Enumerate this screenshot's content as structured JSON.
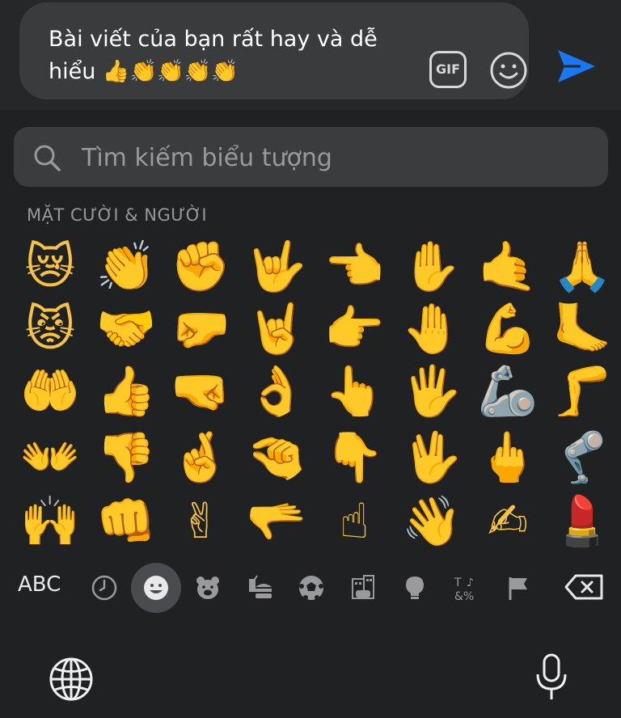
{
  "composer": {
    "message_text": "Bài viết của bạn rất hay và dễ hiểu 👍👏👏👏👏",
    "gif_label": "GIF"
  },
  "search": {
    "placeholder": "Tìm kiếm biểu tượng"
  },
  "category": {
    "title": "MẶT CƯỜI & NGƯỜI"
  },
  "emoji_grid": [
    [
      "😿",
      "👏",
      "✊",
      "🤟",
      "👈",
      "✋",
      "🤙",
      "🙏"
    ],
    [
      "😾",
      "🤝",
      "🤛",
      "🤘",
      "👉",
      "🤚",
      "💪",
      "🦶"
    ],
    [
      "🤲",
      "👍",
      "🤜",
      "👌",
      "👆",
      "🖐",
      "🦾",
      "🦵"
    ],
    [
      "👐",
      "👎",
      "🤞",
      "🤏",
      "👇",
      "🖖",
      "🖕",
      "🦿"
    ],
    [
      "🙌",
      "👊",
      "✌",
      "🫳",
      "☝",
      "👋",
      "✍",
      "💄"
    ]
  ],
  "keyboard": {
    "abc_label": "ABC",
    "categories": [
      {
        "icon": "clock-icon"
      },
      {
        "icon": "smiley-icon"
      },
      {
        "icon": "bear-icon"
      },
      {
        "icon": "food-icon"
      },
      {
        "icon": "soccer-ball-icon"
      },
      {
        "icon": "building-icon"
      },
      {
        "icon": "lightbulb-icon"
      },
      {
        "icon": "symbols-icon"
      },
      {
        "icon": "flag-icon"
      }
    ]
  },
  "colors": {
    "send_blue": "#1877f2",
    "emoji_yellow": "#f5c242"
  }
}
